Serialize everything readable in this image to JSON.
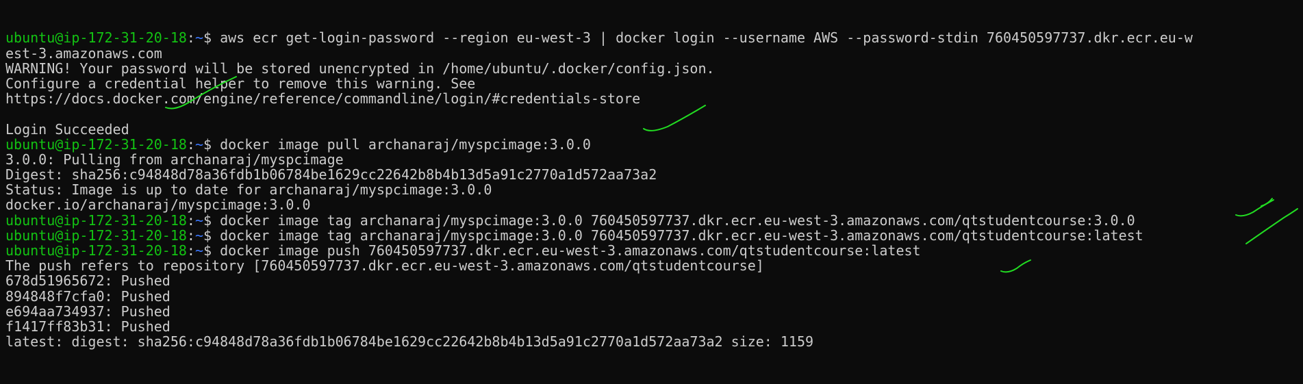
{
  "colors": {
    "background": "#0c0c0c",
    "text": "#cccccc",
    "prompt_user": "#13c313",
    "prompt_path": "#3b78ff",
    "annotation_ink": "#22dd22"
  },
  "prompt": {
    "user_host": "ubuntu@ip-172-31-20-18",
    "colon": ":",
    "path": "~",
    "dollar": "$ "
  },
  "lines": [
    {
      "type": "cmd",
      "text": "aws ecr get-login-password --region eu-west-3 | docker login --username AWS --password-stdin 760450597737.dkr.ecr.eu-w"
    },
    {
      "type": "out",
      "text": "est-3.amazonaws.com"
    },
    {
      "type": "out",
      "text": "WARNING! Your password will be stored unencrypted in /home/ubuntu/.docker/config.json."
    },
    {
      "type": "out",
      "text": "Configure a credential helper to remove this warning. See"
    },
    {
      "type": "out",
      "text": "https://docs.docker.com/engine/reference/commandline/login/#credentials-store"
    },
    {
      "type": "out",
      "text": ""
    },
    {
      "type": "out",
      "text": "Login Succeeded"
    },
    {
      "type": "cmd",
      "text": "docker image pull archanaraj/myspcimage:3.0.0"
    },
    {
      "type": "out",
      "text": "3.0.0: Pulling from archanaraj/myspcimage"
    },
    {
      "type": "out",
      "text": "Digest: sha256:c94848d78a36fdb1b06784be1629cc22642b8b4b13d5a91c2770a1d572aa73a2"
    },
    {
      "type": "out",
      "text": "Status: Image is up to date for archanaraj/myspcimage:3.0.0"
    },
    {
      "type": "out",
      "text": "docker.io/archanaraj/myspcimage:3.0.0"
    },
    {
      "type": "cmd",
      "text": "docker image tag archanaraj/myspcimage:3.0.0 760450597737.dkr.ecr.eu-west-3.amazonaws.com/qtstudentcourse:3.0.0"
    },
    {
      "type": "cmd",
      "text": "docker image tag archanaraj/myspcimage:3.0.0 760450597737.dkr.ecr.eu-west-3.amazonaws.com/qtstudentcourse:latest"
    },
    {
      "type": "cmd",
      "text": "docker image push 760450597737.dkr.ecr.eu-west-3.amazonaws.com/qtstudentcourse:latest"
    },
    {
      "type": "out",
      "text": "The push refers to repository [760450597737.dkr.ecr.eu-west-3.amazonaws.com/qtstudentcourse]"
    },
    {
      "type": "out",
      "text": "678d51965672: Pushed"
    },
    {
      "type": "out",
      "text": "894848f7cfa0: Pushed"
    },
    {
      "type": "out",
      "text": "e694aa734937: Pushed"
    },
    {
      "type": "out",
      "text": "f1417ff83b31: Pushed"
    },
    {
      "type": "out",
      "text": "latest: digest: sha256:c94848d78a36fdb1b06784be1629cc22642b8b4b13d5a91c2770a1d572aa73a2 size: 1159"
    }
  ]
}
